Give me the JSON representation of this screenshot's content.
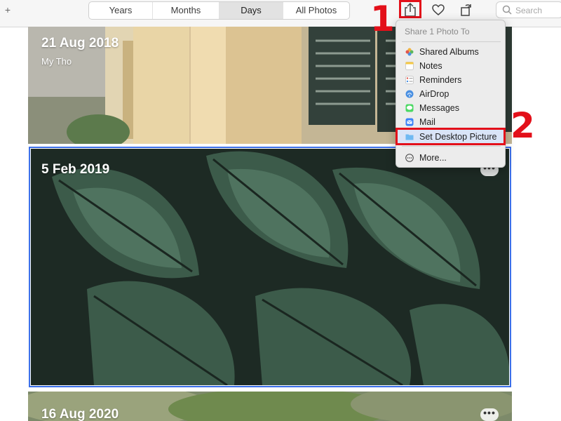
{
  "toolbar": {
    "add_label": "+",
    "tabs": [
      "Years",
      "Months",
      "Days",
      "All Photos"
    ],
    "active_tab": "Days",
    "search_placeholder": "Search",
    "icons": [
      "share-icon",
      "heart-icon",
      "rotate-icon",
      "search-icon"
    ]
  },
  "photos": [
    {
      "date": "21 Aug 2018",
      "place": "My Tho"
    },
    {
      "date": "5 Feb 2019",
      "more": "•••"
    },
    {
      "date": "16 Aug 2020",
      "more": "•••"
    }
  ],
  "share_menu": {
    "header": "Share 1 Photo To",
    "items": [
      {
        "label": "Shared Albums",
        "icon": "photos-icon"
      },
      {
        "label": "Notes",
        "icon": "notes-icon"
      },
      {
        "label": "Reminders",
        "icon": "reminders-icon"
      },
      {
        "label": "AirDrop",
        "icon": "airdrop-icon"
      },
      {
        "label": "Messages",
        "icon": "messages-icon"
      },
      {
        "label": "Mail",
        "icon": "mail-icon"
      },
      {
        "label": "Set Desktop Picture",
        "icon": "folder-icon"
      }
    ],
    "more_label": "More...",
    "highlighted_item": "Set Desktop Picture"
  },
  "annotations": {
    "step1": "1",
    "step2": "2"
  },
  "colors": {
    "annotation_red": "#e3101a",
    "selection_blue": "#3a6ee8"
  }
}
